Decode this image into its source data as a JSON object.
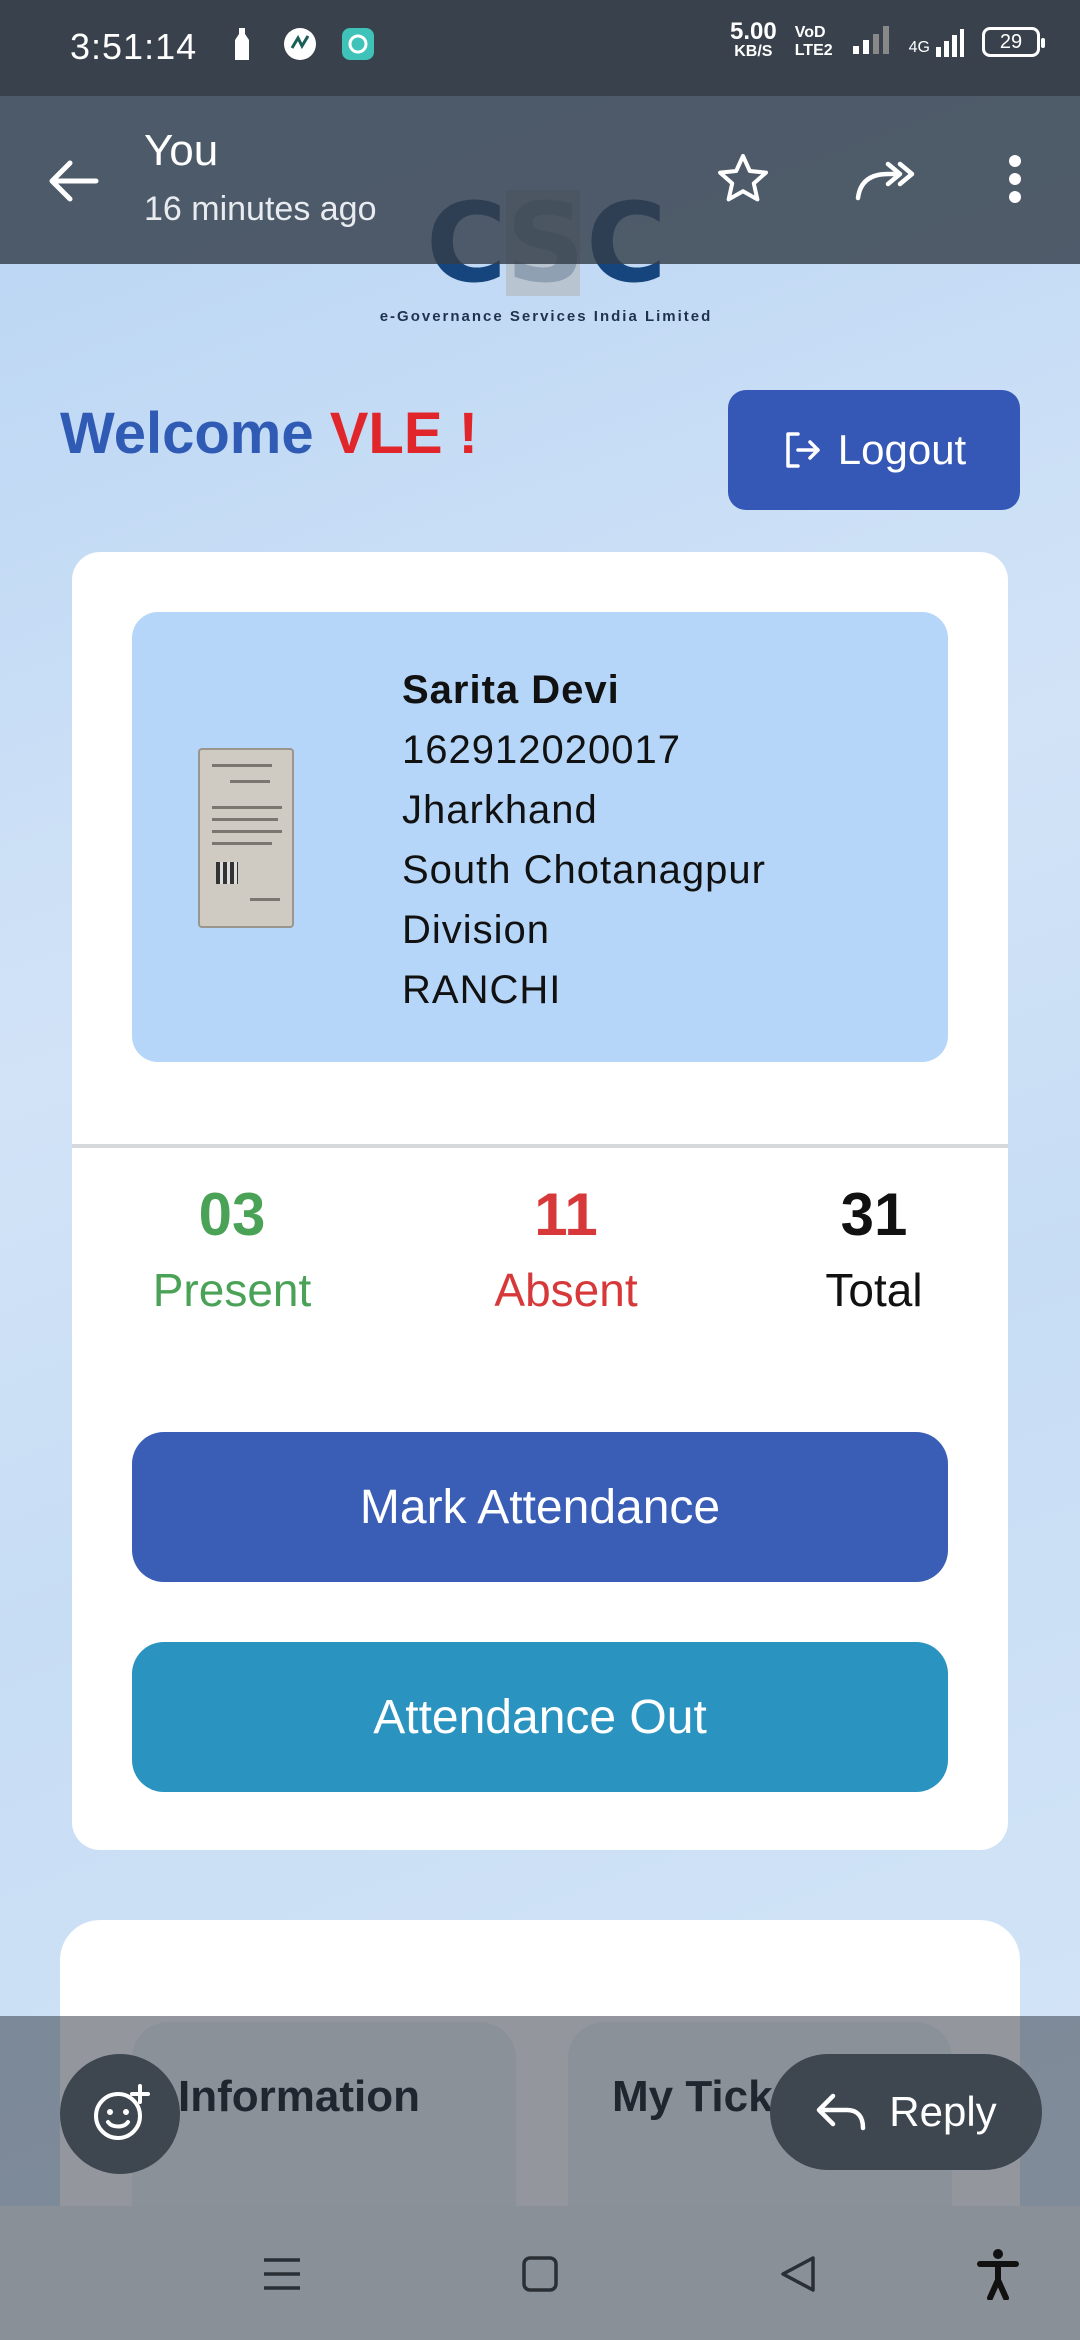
{
  "status_bar": {
    "time": "3:51:14",
    "net_speed_value": "5.00",
    "net_speed_unit": "KB/S",
    "volte_top": "VoD",
    "volte_bottom": "LTE2",
    "signal_label": "4G",
    "battery": "29"
  },
  "viewer": {
    "sender": "You",
    "time_ago": "16 minutes ago"
  },
  "logo": {
    "letters": [
      "C",
      "S",
      "C"
    ],
    "subtitle": "e-Governance Services India Limited"
  },
  "welcome": {
    "prefix": "Welcome",
    "highlight": "VLE !"
  },
  "logout": {
    "label": "Logout"
  },
  "profile": {
    "name": "Sarita Devi",
    "id": "162912020017",
    "state": "Jharkhand",
    "division_line1": "South Chotanagpur",
    "division_line2": "Division",
    "district": "RANCHI"
  },
  "stats": {
    "present": {
      "value": "03",
      "label": "Present"
    },
    "absent": {
      "value": "11",
      "label": "Absent"
    },
    "total": {
      "value": "31",
      "label": "Total"
    }
  },
  "actions": {
    "mark": "Mark Attendance",
    "out": "Attendance Out"
  },
  "tiles": {
    "info": "Information",
    "ticket": "My Ticket"
  },
  "overlay": {
    "reply": "Reply"
  },
  "colors": {
    "primary": "#3a5db6",
    "secondary": "#2a93bf",
    "present": "#4aa257",
    "absent": "#d7393a",
    "welcome_blue": "#2f5bb5",
    "welcome_red": "#e0262b"
  }
}
